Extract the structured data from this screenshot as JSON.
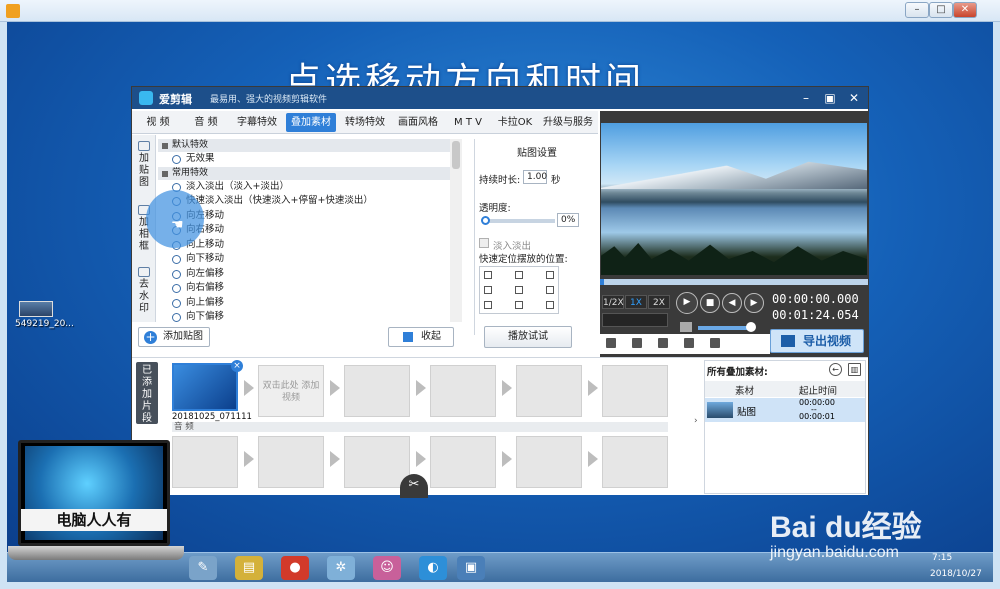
{
  "headline": "点选移动方向和时间",
  "desktop_icon_label": "549219_20...",
  "laptop_watermark": "电脑人人有",
  "watermark": {
    "logo": "Bai du经验",
    "url": "jingyan.baidu.com"
  },
  "taskbar": {
    "time": "7:15",
    "date": "2018/10/27"
  },
  "app": {
    "name": "爱剪辑",
    "slogan": "最易用、强大的视频剪辑软件",
    "tabs": [
      "视 频",
      "音 频",
      "字幕特效",
      "叠加素材",
      "转场特效",
      "画面风格",
      "M T V",
      "卡拉OK",
      "升级与服务"
    ],
    "active_tab": "叠加素材",
    "side_tabs": [
      "加贴图",
      "加相框",
      "去水印"
    ],
    "groups": [
      {
        "label": "默认特效",
        "items": [
          "无效果"
        ]
      },
      {
        "label": "常用特效",
        "items": [
          "淡入淡出（淡入+淡出）",
          "快速淡入淡出（快速淡入+停留+快速淡出）",
          "向左移动",
          "向右移动",
          "向上移动",
          "向下移动",
          "向左偏移",
          "向右偏移",
          "向上偏移",
          "向下偏移"
        ]
      }
    ],
    "add_sticker": "添加贴图",
    "collapse": "收起",
    "settings": {
      "title": "贴图设置",
      "duration_label": "持续时长:",
      "duration_value": "1.00",
      "duration_unit": "秒",
      "opacity_label": "透明度:",
      "opacity_value": "0%",
      "fade_label": "淡入淡出",
      "position_label": "快速定位摆放的位置:",
      "preview_button": "播放试试"
    },
    "player": {
      "speeds": [
        "1/2X",
        "1X",
        "2X"
      ],
      "active_speed": "1X",
      "current_time": "00:00:00.000",
      "total_time": "00:01:24.054",
      "export_button": "导出视频"
    },
    "added_clips_label": "已添加片段",
    "clip_name": "20181025_071111",
    "empty_slot_hint": "双击此处 添加视频",
    "audio_label": "音 频",
    "materials": {
      "title": "所有叠加素材:",
      "col_material": "素材",
      "col_time": "起止时间",
      "row_name": "贴图",
      "row_start": "00:00:00",
      "row_sep": "--",
      "row_end": "00:00:01"
    }
  }
}
